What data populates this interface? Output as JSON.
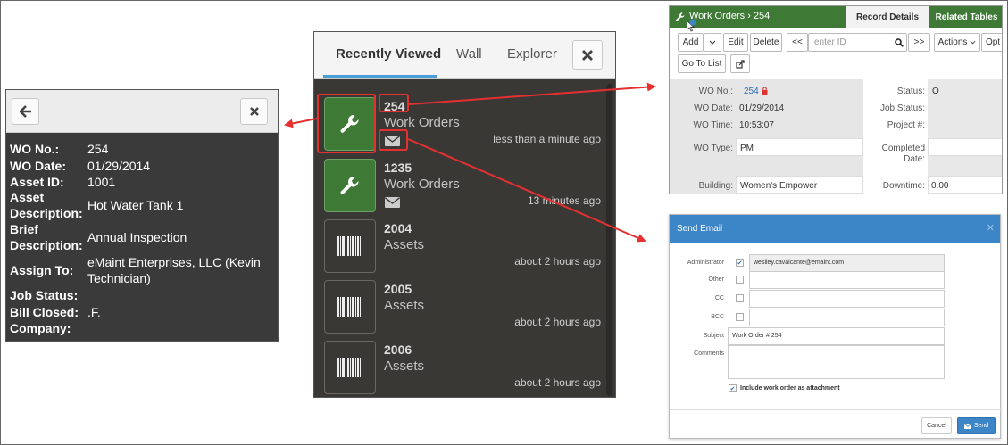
{
  "detail": {
    "rows": [
      {
        "k": "WO No.:",
        "v": "254"
      },
      {
        "k": "WO Date:",
        "v": "01/29/2014"
      },
      {
        "k": "Asset ID:",
        "v": "1001"
      },
      {
        "k": "Asset Description:",
        "v": "Hot Water Tank 1"
      },
      {
        "k": "Brief Description:",
        "v": "Annual Inspection"
      },
      {
        "k": "Assign To:",
        "v": "eMaint Enterprises, LLC (Kevin Technician)"
      },
      {
        "k": "Job Status:",
        "v": ""
      },
      {
        "k": "Bill Closed:",
        "v": ".F."
      },
      {
        "k": "Company:",
        "v": ""
      }
    ]
  },
  "mid": {
    "tabs": [
      "Recently Viewed",
      "Wall",
      "Explorer"
    ],
    "items": [
      {
        "id": "254",
        "type": "Work Orders",
        "time": "less than a minute ago",
        "icon": "wrench-icon"
      },
      {
        "id": "1235",
        "type": "Work Orders",
        "time": "13 minutes ago",
        "icon": "wrench-icon"
      },
      {
        "id": "2004",
        "type": "Assets",
        "time": "about 2 hours ago",
        "icon": "barcode-icon"
      },
      {
        "id": "2005",
        "type": "Assets",
        "time": "about 2 hours ago",
        "icon": "barcode-icon"
      },
      {
        "id": "2006",
        "type": "Assets",
        "time": "about 2 hours ago",
        "icon": "barcode-icon"
      }
    ]
  },
  "wo": {
    "title": "Work Orders › 254",
    "tabs": [
      "Record Details",
      "Related Tables"
    ],
    "toolbar": {
      "add": "Add",
      "edit": "Edit",
      "delete": "Delete",
      "prev": "<<",
      "placeholder": "enter ID",
      "next": ">>",
      "actions": "Actions",
      "options": "Opt",
      "goto": "Go To List"
    },
    "fields": {
      "wo_no_label": "WO No.:",
      "wo_no": "254",
      "status_label": "Status:",
      "status": "O",
      "wo_date_label": "WO Date:",
      "wo_date": "01/29/2014",
      "job_status_label": "Job Status:",
      "wo_time_label": "WO Time:",
      "wo_time": "10:53:07",
      "project_label": "Project #:",
      "wo_type_label": "WO Type:",
      "wo_type": "PM",
      "completed_label": "Completed",
      "completed_label2": "Date:",
      "building_label": "Building:",
      "building": "Women's Empower",
      "downtime_label": "Downtime:",
      "downtime": "0.00"
    }
  },
  "email": {
    "title": "Send Email",
    "rows": [
      {
        "label": "Administrator",
        "checked": true,
        "value": "weslley.cavalcante@emaint.com"
      },
      {
        "label": "Other",
        "checked": false,
        "value": ""
      },
      {
        "label": "CC",
        "checked": false,
        "value": ""
      },
      {
        "label": "BCC",
        "checked": false,
        "value": ""
      }
    ],
    "subject_label": "Subject",
    "subject": "Work Order # 254",
    "comments_label": "Comments",
    "attach_label": "Include work order as attachment",
    "cancel": "Cancel",
    "send": "Send"
  },
  "colors": {
    "green": "#3e7a36",
    "blue": "#3c86c8",
    "highlight": "#e53030"
  }
}
